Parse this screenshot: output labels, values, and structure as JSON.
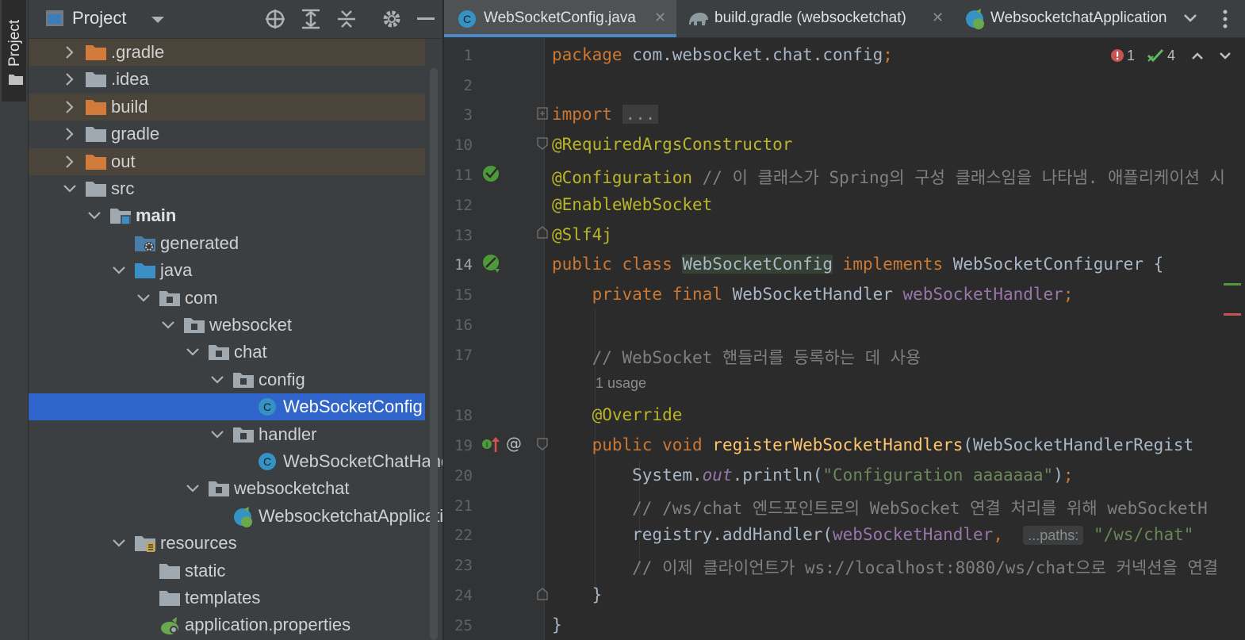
{
  "sidebar": {
    "tool_window_label": "Project"
  },
  "project_panel": {
    "title": "Project",
    "tree": [
      {
        "label": ".gradle",
        "depth": 0,
        "expanded": false,
        "icon": "folder-excluded",
        "highlight": true
      },
      {
        "label": ".idea",
        "depth": 0,
        "expanded": false,
        "icon": "folder",
        "highlight": false
      },
      {
        "label": "build",
        "depth": 0,
        "expanded": false,
        "icon": "folder-excluded",
        "highlight": true
      },
      {
        "label": "gradle",
        "depth": 0,
        "expanded": false,
        "icon": "folder",
        "highlight": false
      },
      {
        "label": "out",
        "depth": 0,
        "expanded": false,
        "icon": "folder-excluded",
        "highlight": true
      },
      {
        "label": "src",
        "depth": 0,
        "expanded": true,
        "icon": "folder",
        "highlight": false
      },
      {
        "label": "main",
        "depth": 1,
        "expanded": true,
        "icon": "folder-module",
        "highlight": false,
        "bold": true
      },
      {
        "label": "generated",
        "depth": 2,
        "expanded": null,
        "icon": "folder-generated",
        "highlight": false
      },
      {
        "label": "java",
        "depth": 2,
        "expanded": true,
        "icon": "folder-source",
        "highlight": false
      },
      {
        "label": "com",
        "depth": 3,
        "expanded": true,
        "icon": "package",
        "highlight": false
      },
      {
        "label": "websocket",
        "depth": 4,
        "expanded": true,
        "icon": "package",
        "highlight": false
      },
      {
        "label": "chat",
        "depth": 5,
        "expanded": true,
        "icon": "package",
        "highlight": false
      },
      {
        "label": "config",
        "depth": 6,
        "expanded": true,
        "icon": "package",
        "highlight": false
      },
      {
        "label": "WebSocketConfig",
        "depth": 7,
        "expanded": null,
        "icon": "class",
        "highlight": false,
        "selected": true
      },
      {
        "label": "handler",
        "depth": 6,
        "expanded": true,
        "icon": "package",
        "highlight": false
      },
      {
        "label": "WebSocketChatHandler",
        "depth": 7,
        "expanded": null,
        "icon": "class",
        "highlight": false
      },
      {
        "label": "websocketchat",
        "depth": 5,
        "expanded": true,
        "icon": "package",
        "highlight": false
      },
      {
        "label": "WebsocketchatApplication",
        "depth": 6,
        "expanded": null,
        "icon": "spring-class",
        "highlight": false
      },
      {
        "label": "resources",
        "depth": 2,
        "expanded": true,
        "icon": "folder-resources",
        "highlight": false
      },
      {
        "label": "static",
        "depth": 3,
        "expanded": null,
        "icon": "folder",
        "highlight": false
      },
      {
        "label": "templates",
        "depth": 3,
        "expanded": null,
        "icon": "folder",
        "highlight": false
      },
      {
        "label": "application.properties",
        "depth": 3,
        "expanded": null,
        "icon": "spring-properties",
        "highlight": false
      }
    ]
  },
  "editor": {
    "tabs": [
      {
        "label": "WebSocketConfig.java",
        "active": true,
        "icon": "class"
      },
      {
        "label": "build.gradle (websocketchat)",
        "active": false,
        "icon": "gradle-elephant"
      },
      {
        "label": "WebsocketchatApplication",
        "active": false,
        "icon": "spring-class"
      }
    ],
    "inspections": {
      "errors": "1",
      "ok": "4"
    },
    "usage_hint": "1 usage",
    "param_hint": "...paths:",
    "lines": [
      {
        "n": "1",
        "s": [
          [
            "kw",
            "package "
          ],
          [
            "",
            "com.websocket.chat.config"
          ],
          [
            "kw",
            ";"
          ]
        ]
      },
      {
        "n": "2",
        "s": []
      },
      {
        "n": "3",
        "s": [
          [
            "kw",
            "import "
          ],
          [
            "fold",
            "..."
          ]
        ]
      },
      {
        "n": "10",
        "s": [
          [
            "ann",
            "@RequiredArgsConstructor"
          ]
        ]
      },
      {
        "n": "11",
        "s": [
          [
            "ann",
            "@Configuration"
          ],
          [
            "cmt",
            " // 이 클래스가 Spring의 구성 클래스임을 나타냄. 애플리케이션 시"
          ]
        ]
      },
      {
        "n": "12",
        "s": [
          [
            "ann",
            "@EnableWebSocket"
          ]
        ]
      },
      {
        "n": "13",
        "s": [
          [
            "ann",
            "@Slf4j"
          ]
        ]
      },
      {
        "n": "14",
        "s": [
          [
            "kw",
            "public class "
          ],
          [
            "clshl",
            "WebSocketConfig"
          ],
          [
            "kw",
            " implements "
          ],
          [
            "",
            "WebSocketConfigurer {"
          ]
        ]
      },
      {
        "n": "15",
        "s": [
          [
            "",
            "    "
          ],
          [
            "kw",
            "private final "
          ],
          [
            "",
            "WebSocketHandler "
          ],
          [
            "fld",
            "webSocketHandler"
          ],
          [
            "kw",
            ";"
          ]
        ]
      },
      {
        "n": "16",
        "s": []
      },
      {
        "n": "17",
        "s": [
          [
            "cmt",
            "    // WebSocket 핸들러를 등록하는 데 사용"
          ]
        ]
      },
      {
        "n": "18",
        "s": [
          [
            "",
            "    "
          ],
          [
            "ann",
            "@Override"
          ]
        ]
      },
      {
        "n": "19",
        "s": [
          [
            "",
            "    "
          ],
          [
            "kw",
            "public void "
          ],
          [
            "mth",
            "registerWebSocketHandlers"
          ],
          [
            "",
            "(WebSocketHandlerRegist"
          ]
        ]
      },
      {
        "n": "20",
        "s": [
          [
            "",
            "        System."
          ],
          [
            "itl",
            "out"
          ],
          [
            "",
            ".println("
          ],
          [
            "str",
            "\"Configuration aaaaaaa\""
          ],
          [
            "",
            ")"
          ],
          [
            "kw",
            ";"
          ]
        ]
      },
      {
        "n": "21",
        "s": [
          [
            "cmt",
            "        // /ws/chat 엔드포인트로의 WebSocket 연결 처리를 위해 webSocketH"
          ]
        ]
      },
      {
        "n": "22",
        "s": [
          [
            "",
            "        registry.addHandler("
          ],
          [
            "fld",
            "webSocketHandler"
          ],
          [
            "kw",
            ","
          ],
          [
            "",
            "  "
          ],
          [
            "hint",
            "...paths:"
          ],
          [
            "",
            ""
          ],
          [
            "str",
            " \"/ws/chat\""
          ]
        ]
      },
      {
        "n": "23",
        "s": [
          [
            "cmt",
            "        // 이제 클라이언트가 ws://localhost:8080/ws/chat으로 커넥션을 연결"
          ]
        ]
      },
      {
        "n": "24",
        "s": [
          [
            "",
            "    }"
          ]
        ]
      },
      {
        "n": "25",
        "s": [
          [
            "",
            "}"
          ]
        ]
      }
    ]
  }
}
